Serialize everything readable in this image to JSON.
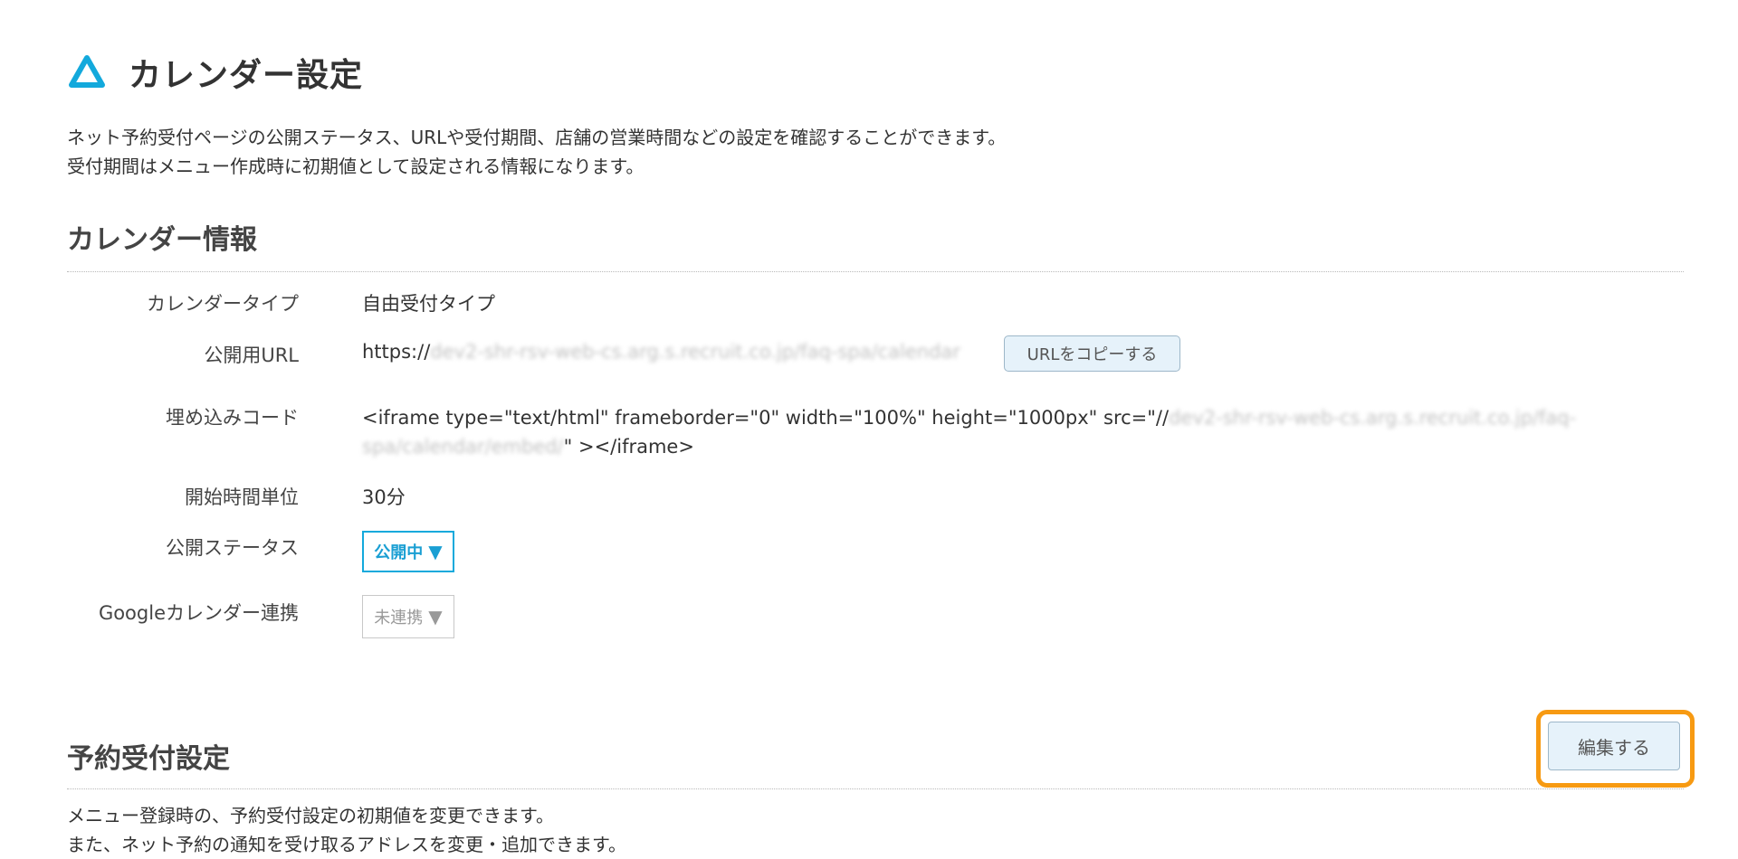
{
  "header": {
    "icon": "triangle-outline-icon",
    "title": "カレンダー設定"
  },
  "intro": {
    "line1": "ネット予約受付ページの公開ステータス、URLや受付期間、店舗の営業時間などの設定を確認することができます。",
    "line2": "受付期間はメニュー作成時に初期値として設定される情報になります。"
  },
  "calendar_info": {
    "title": "カレンダー情報",
    "rows": {
      "type": {
        "label": "カレンダータイプ",
        "value": "自由受付タイプ"
      },
      "url": {
        "label": "公開用URL",
        "prefix": "https://",
        "blurred": "dev2-shr-rsv-web-cs.arg.s.recruit.co.jp/faq-spa/calendar",
        "copy_button": "URLをコピーする"
      },
      "embed": {
        "label": "埋め込みコード",
        "line1_visible": "<iframe type=\"text/html\" frameborder=\"0\" width=\"100%\" height=\"1000px\" src=\"//",
        "line1_blurred": "dev2-shr-rsv-web-cs.arg.s.recruit.co.jp/faq-",
        "line2_blurred": "spa/calendar/embed/",
        "line2_visible": "\" ></iframe>"
      },
      "start_unit": {
        "label": "開始時間単位",
        "value": "30分"
      },
      "status": {
        "label": "公開ステータス",
        "selected": "公開中",
        "arrow": "▼"
      },
      "google": {
        "label": "Googleカレンダー連携",
        "selected": "未連携",
        "arrow": "▼"
      }
    }
  },
  "reservation_settings": {
    "title": "予約受付設定",
    "edit_button": "編集する",
    "desc_line1": "メニュー登録時の、予約受付設定の初期値を変更できます。",
    "desc_line2": "また、ネット予約の通知を受け取るアドレスを変更・追加できます。"
  },
  "colors": {
    "accent": "#13a9dc",
    "highlight": "#f79a12",
    "button_bg": "#e6f2fa"
  }
}
